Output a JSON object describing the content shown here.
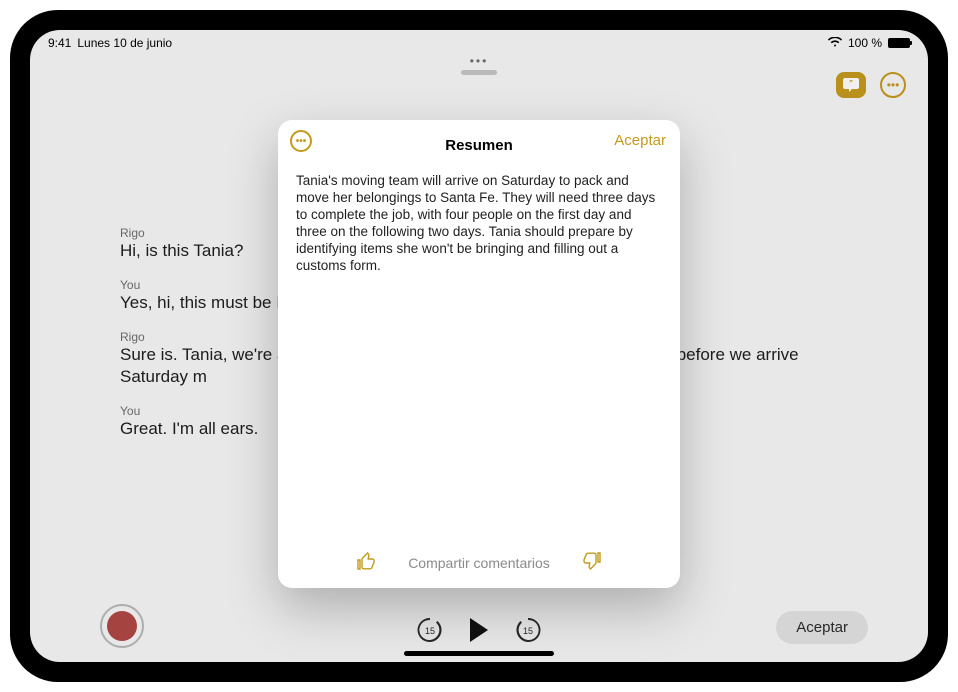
{
  "statusbar": {
    "time": "9:41",
    "date": "Lunes 10 de junio",
    "battery_text": "100 %"
  },
  "transcript": [
    {
      "speaker": "Rigo",
      "text": "Hi, is this Tania?"
    },
    {
      "speaker": "You",
      "text": "Yes, hi, this must be I"
    },
    {
      "speaker": "Rigo",
      "text": "Sure is. Tania, we're a                                                                               o chat with you beforehand to go ove                                                                           u might have before we arrive Saturday m"
    },
    {
      "speaker": "You",
      "text": "Great. I'm all ears."
    }
  ],
  "bottom": {
    "accept_label": "Aceptar"
  },
  "modal": {
    "title": "Resumen",
    "accept_label": "Aceptar",
    "body": "Tania's moving team will arrive on Saturday to pack and move her belongings to Santa Fe. They will need three days to complete the job, with four people on the first day and three on the following two days. Tania should prepare by identifying items she won't be bringing and filling out a customs form.",
    "feedback_label": "Compartir comentarios"
  },
  "colors": {
    "accent": "#c49a1d"
  }
}
